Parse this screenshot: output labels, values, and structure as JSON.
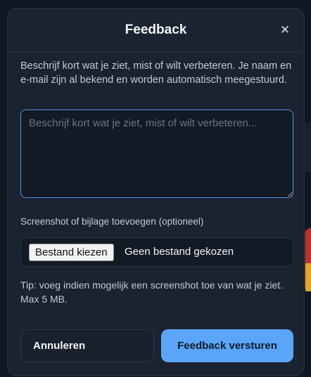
{
  "modal": {
    "title": "Feedback",
    "close_icon": "close-icon",
    "close_glyph": "✕",
    "intro": "Beschrijf kort wat je ziet, mist of wilt verbeteren. Je naam en e-mail zijn al bekend en worden automatisch meegestuurd.",
    "message": {
      "value": "",
      "placeholder": "Beschrijf kort wat je ziet, mist of wilt verbeteren..."
    },
    "attachment": {
      "label": "Screenshot of bijlage toevoegen (optioneel)",
      "button_label": "Bestand kiezen",
      "status": "Geen bestand gekozen"
    },
    "tip": "Tip: voeg indien mogelijk een screenshot toe van wat je ziet. Max 5 MB.",
    "actions": {
      "cancel_label": "Annuleren",
      "submit_label": "Feedback versturen"
    }
  },
  "colors": {
    "accent": "#5aa5f8",
    "focus_border": "#4d97e8",
    "modal_background": "#1c2330"
  }
}
